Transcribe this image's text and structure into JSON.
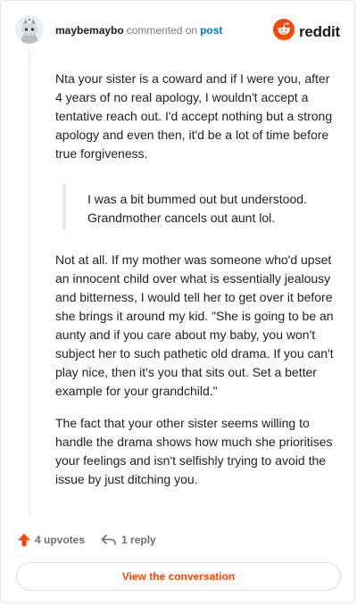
{
  "header": {
    "username": "maybemaybo",
    "action": "commented on",
    "target": "post",
    "brand": "reddit"
  },
  "comment": {
    "paragraph_1": "Nta your sister is a coward and if I were you, after 4 years of no real apology, I wouldn't accept a tentative reach out. I'd accept nothing but a strong apology and even then, it'd be a lot of time before true forgiveness.",
    "quote": "I was a bit bummed out but understood. Grandmother cancels out aunt lol.",
    "paragraph_2": "Not at all. If my mother was someone who'd upset an innocent child over what is essentially jealousy and bitterness, I would tell her to get over it before she brings it around my kid. \"She is going to be an aunty and if you care about my baby, you won't subject her to such pathetic old drama. If you can't play nice, then it's you that sits out. Set a better example for your grandchild.\"",
    "paragraph_3": "The fact that your other sister seems willing to handle the drama shows how much she prioritises your feelings and isn't selfishly trying to avoid the issue by just ditching you."
  },
  "footer": {
    "upvotes": "4 upvotes",
    "replies": "1 reply",
    "cta": "View the conversation"
  },
  "colors": {
    "brand": "#ff4500",
    "link": "#0079d3",
    "muted": "#7c7c7c"
  },
  "icons": [
    "avatar",
    "reddit-logo-icon",
    "upvote-arrow-icon",
    "reply-icon"
  ]
}
